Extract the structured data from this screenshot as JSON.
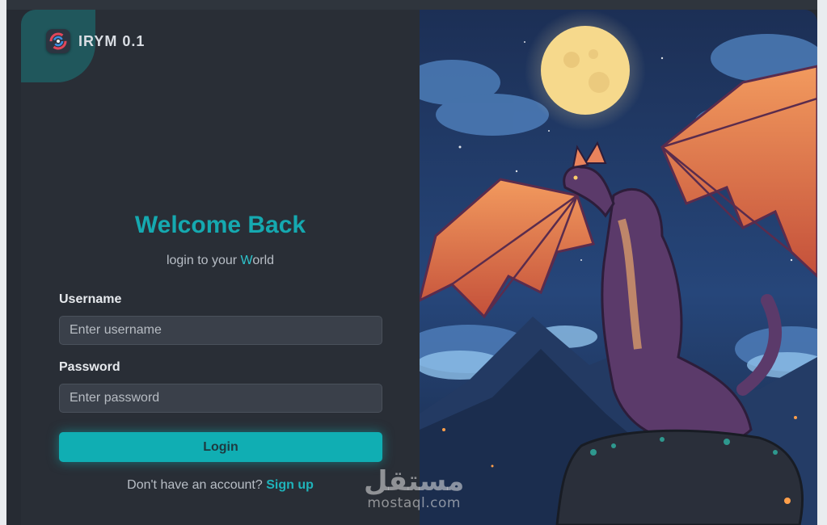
{
  "brand": {
    "name": "IRYM 0.1"
  },
  "login": {
    "title": "Welcome Back",
    "subtitle_prefix": "login to your ",
    "subtitle_accent": "W",
    "subtitle_suffix": "orld",
    "username_label": "Username",
    "username_placeholder": "Enter username",
    "password_label": "Password",
    "password_placeholder": "Enter password",
    "login_button": "Login",
    "signup_prompt": "Don't have an account? ",
    "signup_link": "Sign up"
  },
  "watermark": {
    "arabic": "مستقل",
    "latin": "mostaql.com"
  },
  "colors": {
    "accent": "#10aeb3",
    "background": "#262b33",
    "panel": "#292e36"
  }
}
